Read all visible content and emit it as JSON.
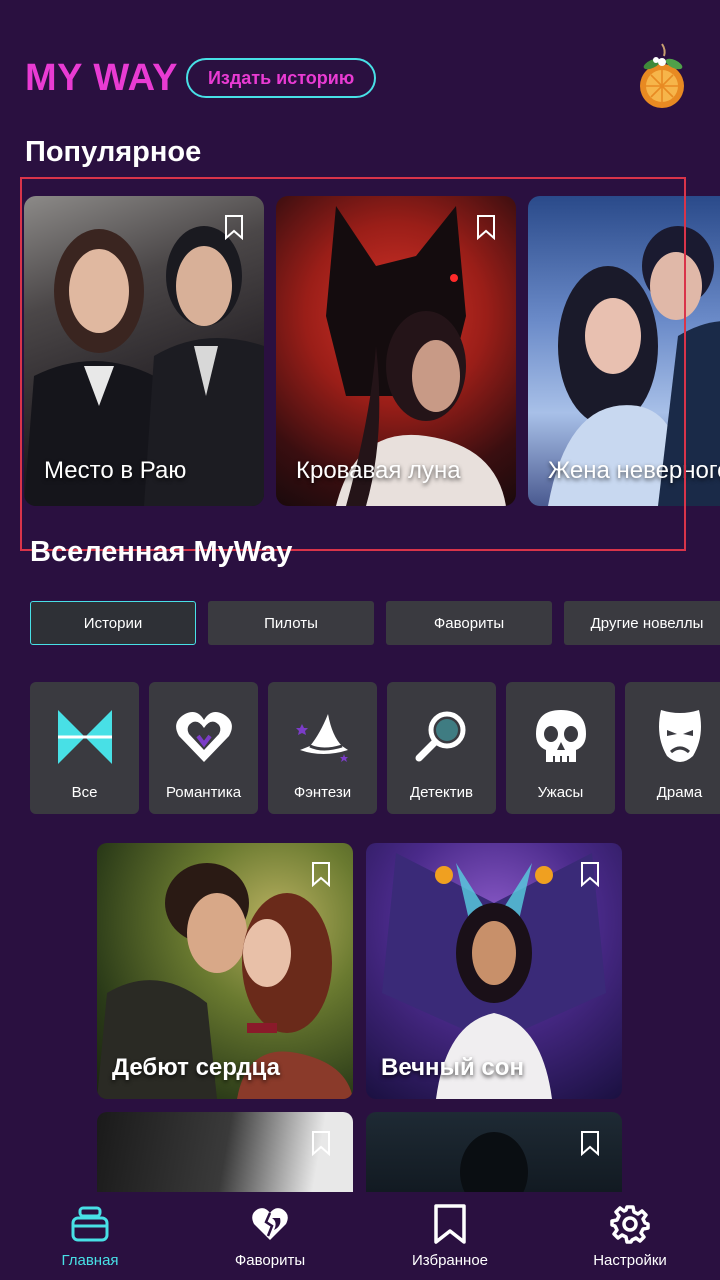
{
  "header": {
    "logo": "MY WAY",
    "publish_label": "Издать историю"
  },
  "popular": {
    "title": "Популярное",
    "cards": [
      {
        "title": "Место в Раю"
      },
      {
        "title": "Кровавая луна"
      },
      {
        "title": "Жена неверного ректора"
      }
    ]
  },
  "universe": {
    "title": "Вселенная MyWay",
    "tabs": [
      "Истории",
      "Пилоты",
      "Фавориты",
      "Другие новеллы"
    ],
    "active_tab": "Истории"
  },
  "genres": [
    "Все",
    "Романтика",
    "Фэнтези",
    "Детектив",
    "Ужасы",
    "Драма"
  ],
  "stories": [
    {
      "title": "Дебют сердца"
    },
    {
      "title": "Вечный сон"
    },
    {
      "title": ""
    },
    {
      "title": ""
    }
  ],
  "nav": {
    "items": [
      "Главная",
      "Фавориты",
      "Избранное",
      "Настройки"
    ],
    "active": "Главная",
    "accent_color": "#48e0e6"
  },
  "colors": {
    "background": "#2a1040",
    "brand_pink": "#e93bd3",
    "accent_cyan": "#48e0e6",
    "tile": "#3a3a40"
  }
}
